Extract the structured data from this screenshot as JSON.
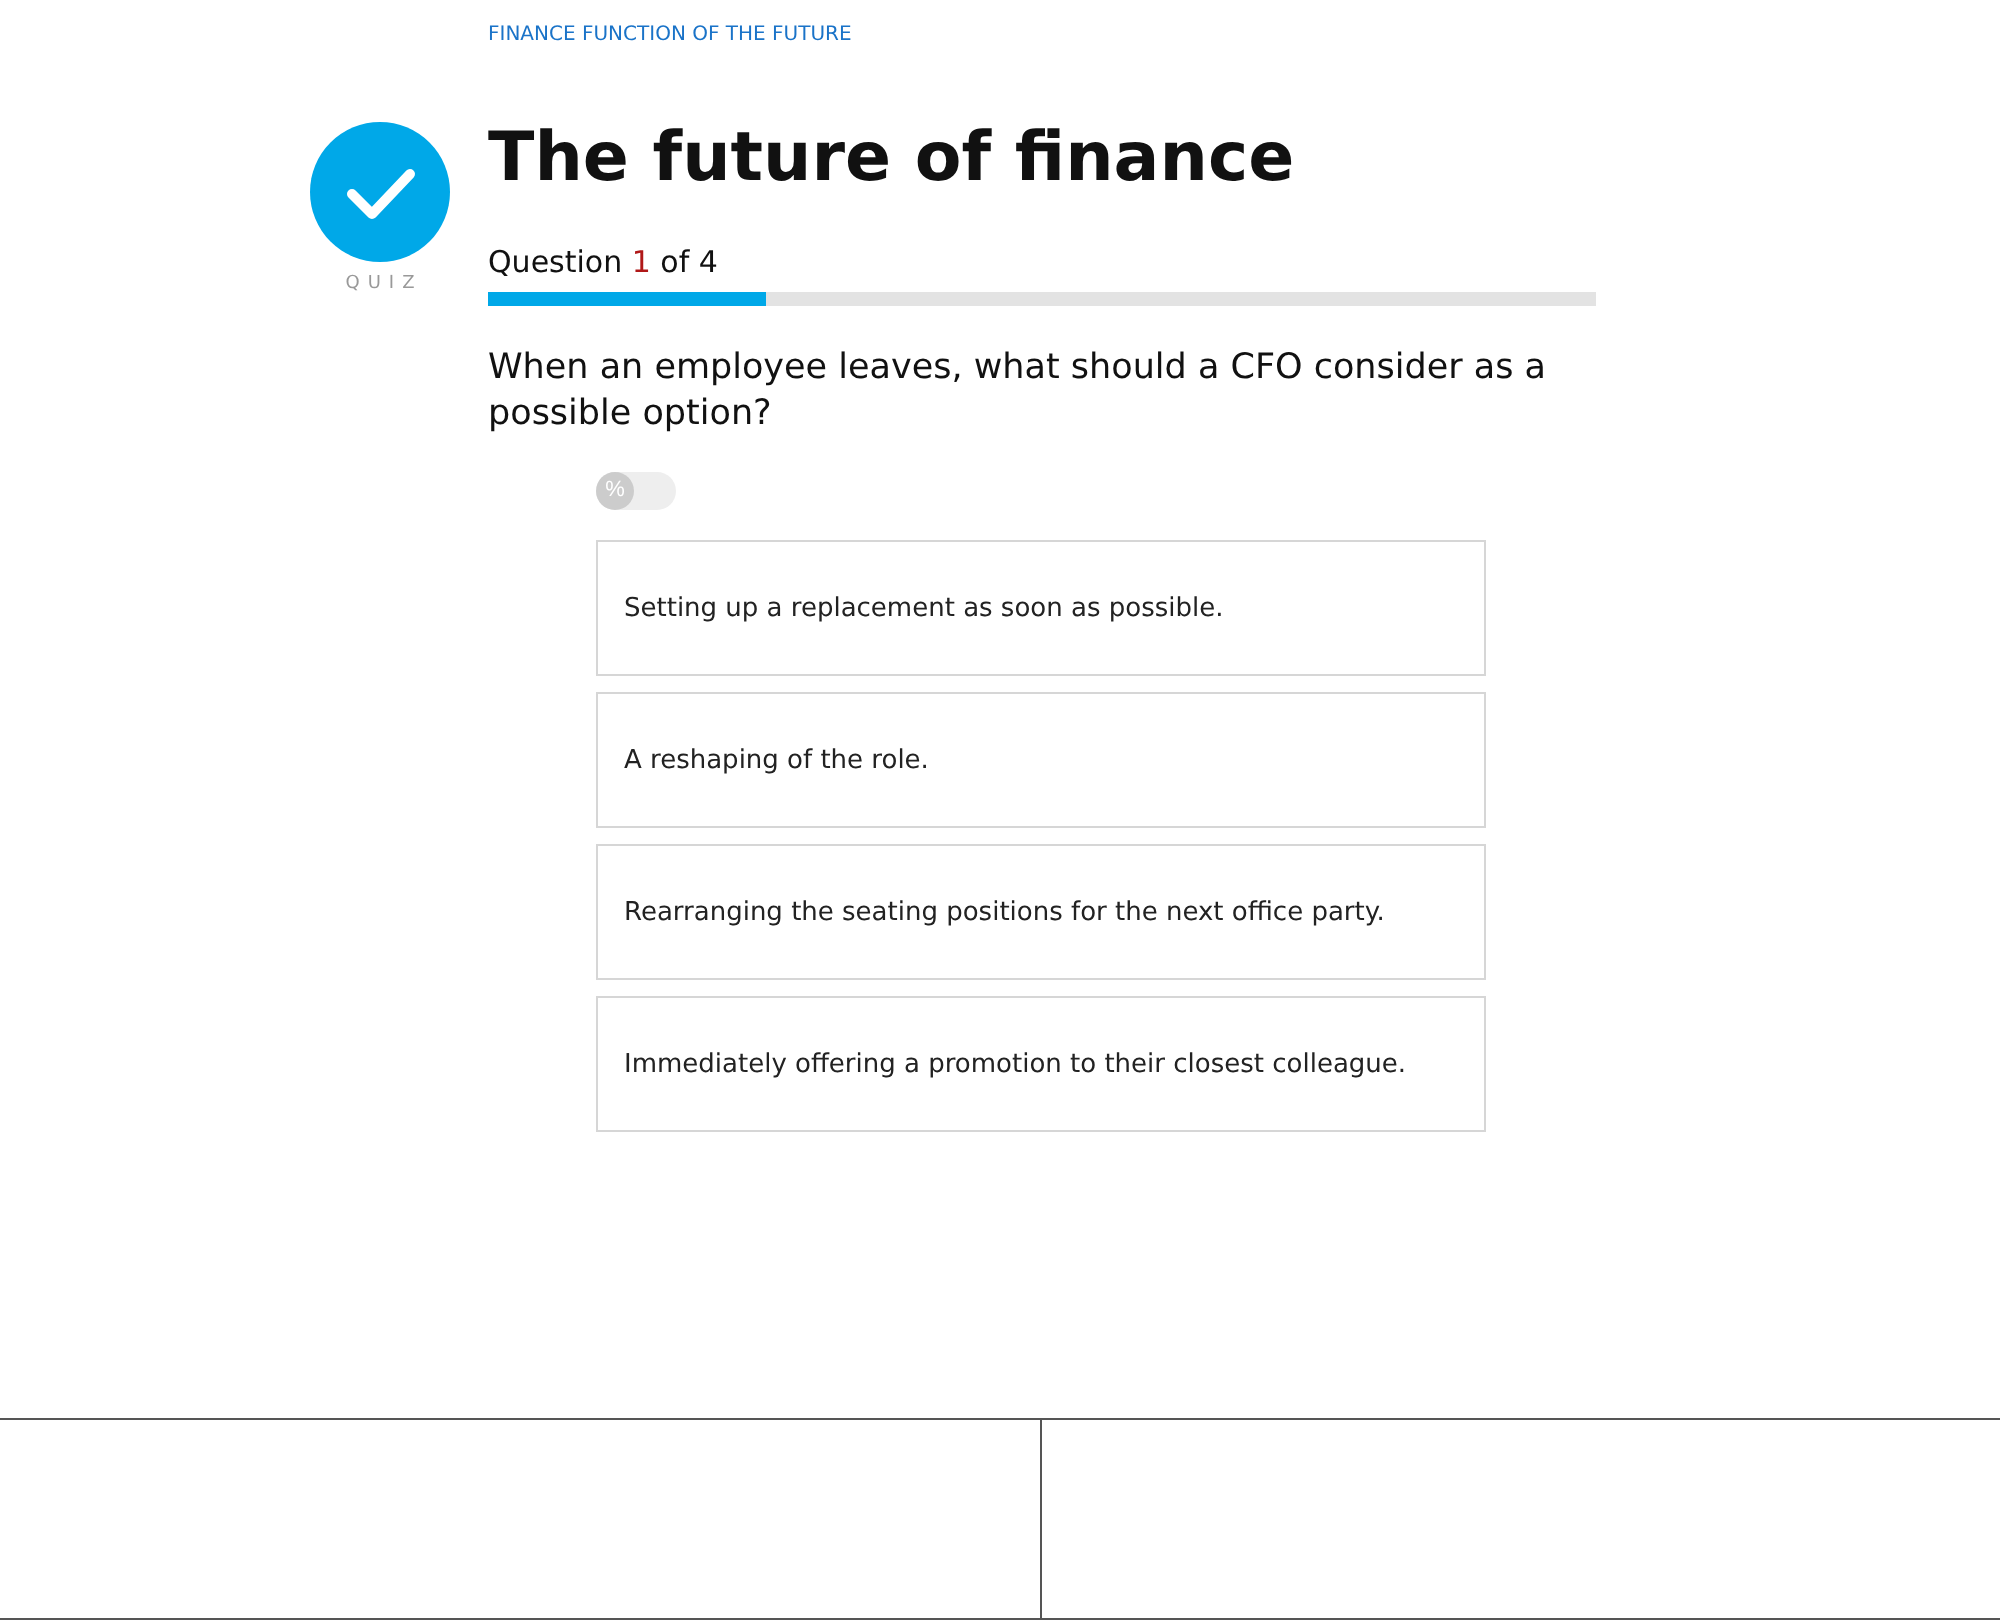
{
  "category": "FINANCE FUNCTION OF THE FUTURE",
  "badge_label": "QUIZ",
  "title": "The future of finance",
  "progress": {
    "question_word": "Question",
    "current": "1",
    "of_word": "of",
    "total": "4",
    "level": 0.25
  },
  "question": "When an employee leaves, what should a CFO consider as a possible option?",
  "toggle": {
    "symbol": "%",
    "on": false
  },
  "options": [
    {
      "text": "Setting up a replacement as soon as possible.",
      "selected": false
    },
    {
      "text": "A reshaping of the role.",
      "selected": false
    },
    {
      "text": "Rearranging the seating positions for the next office party.",
      "selected": false
    },
    {
      "text": "Immediately offering a promotion to their closest colleague.",
      "selected": false
    }
  ]
}
